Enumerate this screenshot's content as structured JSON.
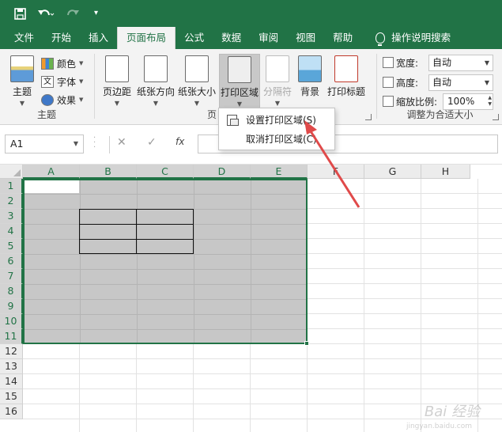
{
  "qat": {
    "more": "▾"
  },
  "tabs": [
    "文件",
    "开始",
    "插入",
    "页面布局",
    "公式",
    "数据",
    "审阅",
    "视图",
    "帮助"
  ],
  "search_label": "操作说明搜索",
  "theme_group": {
    "label": "主题",
    "theme_btn": "主题",
    "colors": "颜色",
    "fonts": "字体",
    "effects": "效果",
    "font_glyph": "文"
  },
  "page_setup": {
    "label": "页",
    "margins": "页边距",
    "orientation": "纸张方向",
    "size": "纸张大小",
    "print_area": "打印区域",
    "breaks": "分隔符",
    "background": "背景",
    "print_titles": "打印标题"
  },
  "scale_group": {
    "label": "调整为合适大小",
    "width_label": "宽度:",
    "width_value": "自动",
    "height_label": "高度:",
    "height_value": "自动",
    "scale_label": "缩放比例:",
    "scale_value": "100%"
  },
  "menu": {
    "set_print_area": "设置打印区域(S)",
    "clear_print_area": "取消打印区域(C)"
  },
  "formula_bar": {
    "name_box": "A1",
    "fx": "fx",
    "cancel": "✕",
    "enter": "✓"
  },
  "columns": [
    "A",
    "B",
    "C",
    "D",
    "E",
    "F",
    "G",
    "H"
  ],
  "rows": [
    "1",
    "2",
    "3",
    "4",
    "5",
    "6",
    "7",
    "8",
    "9",
    "10",
    "11",
    "12",
    "13",
    "14",
    "15",
    "16"
  ],
  "watermark": "Bai 经验",
  "watermark_sub": "jingyan.baidu.com",
  "colors": {
    "excel_green": "#217346",
    "selection_gray": "#c7c7c7",
    "arrow_red": "#e04a4a"
  }
}
